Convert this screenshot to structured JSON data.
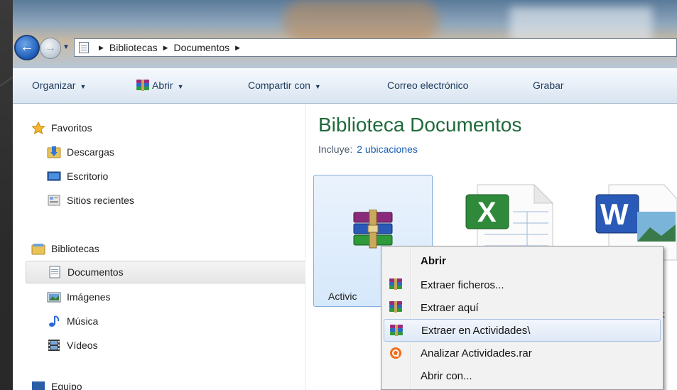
{
  "address_bar": {
    "crumbs": [
      "Bibliotecas",
      "Documentos"
    ]
  },
  "toolbar": {
    "organize": "Organizar",
    "open": "Abrir",
    "share": "Compartir con",
    "email": "Correo electrónico",
    "burn": "Grabar"
  },
  "sidebar": {
    "favorites": "Favoritos",
    "downloads": "Descargas",
    "desktop": "Escritorio",
    "recent": "Sitios recientes",
    "libraries": "Bibliotecas",
    "documents": "Documentos",
    "images": "Imágenes",
    "music": "Música",
    "videos": "Vídeos",
    "computer_partial": "Equipo"
  },
  "content": {
    "title": "Biblioteca Documentos",
    "includes_label": "Incluye:",
    "includes_link": "2 ubicaciones",
    "files": [
      {
        "label": "Activic",
        "icon": "winrar-archive-icon"
      },
      {
        "label": "",
        "icon": "excel-file-icon"
      },
      {
        "label_line1": "of",
        "label_line2": "locx",
        "icon": "word-file-icon"
      }
    ]
  },
  "context_menu": {
    "items": [
      {
        "label": "Abrir",
        "bold": true,
        "icon": ""
      },
      {
        "label": "Extraer ficheros...",
        "icon": "winrar-icon"
      },
      {
        "label": "Extraer aquí",
        "icon": "winrar-icon"
      },
      {
        "label": "Extraer en Actividades\\",
        "icon": "winrar-icon",
        "highlighted": true
      },
      {
        "label": "Analizar Actividades.rar",
        "icon": "avast-icon"
      },
      {
        "label": "Abrir con...",
        "icon": ""
      }
    ]
  },
  "colors": {
    "library_title": "#1e6a3a",
    "link": "#1a5fb4",
    "toolbar_text": "#1e395b"
  }
}
